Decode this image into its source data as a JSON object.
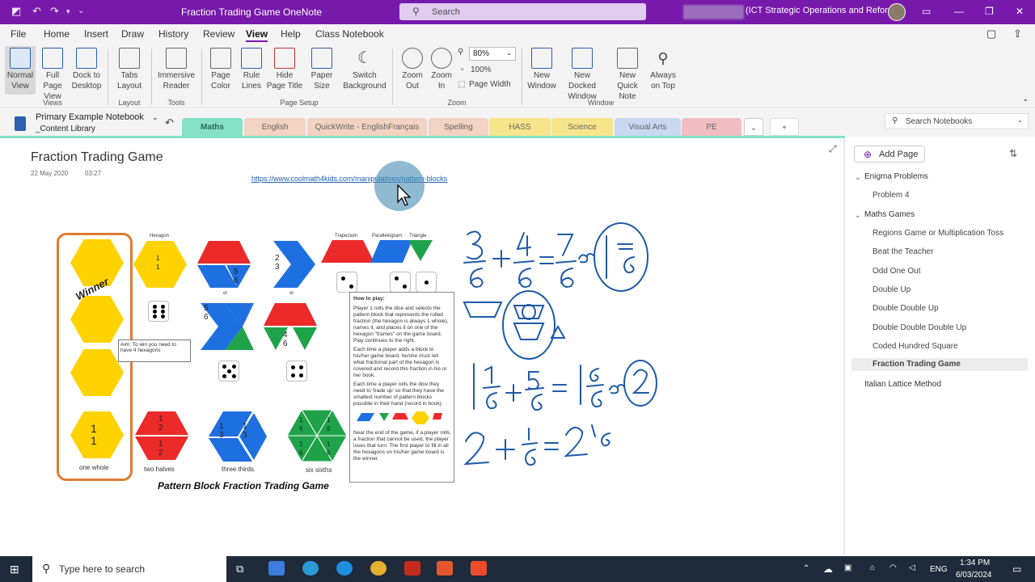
{
  "titlebar": {
    "app_title": "Fraction Trading Game   OneNote",
    "search_placeholder": "Search",
    "account": "(ICT Strategic Operations and Reform)"
  },
  "menu": {
    "items": [
      "File",
      "Home",
      "Insert",
      "Draw",
      "History",
      "Review",
      "View",
      "Help",
      "Class Notebook"
    ],
    "active": "View"
  },
  "ribbon": {
    "views": {
      "normal": "Normal View",
      "fullpage": "Full Page View",
      "dock": "Dock to Desktop",
      "group": "Views"
    },
    "layout": {
      "tabs": "Tabs Layout",
      "group": "Layout"
    },
    "tools": {
      "immersive": "Immersive Reader",
      "group": "Tools"
    },
    "pagesetup": {
      "color": "Page Color",
      "rule": "Rule Lines",
      "hide": "Hide Page Title",
      "paper": "Paper Size",
      "switchbg": "Switch Background",
      "group": "Page Setup"
    },
    "zoom": {
      "out": "Zoom Out",
      "in": "Zoom In",
      "value": "80%",
      "hundred": "100%",
      "pagewidth": "Page Width",
      "group": "Zoom"
    },
    "window": {
      "newwin": "New Window",
      "docked": "New Docked Window",
      "quicknote": "New Quick Note",
      "ontop": "Always on Top",
      "group": "Window"
    }
  },
  "notebook": {
    "name": "Primary Example Notebook",
    "section_group": "_Content Library",
    "tabs": [
      {
        "label": "Maths",
        "color": "#86e0c6"
      },
      {
        "label": "English",
        "color": "#f2d2c2"
      },
      {
        "label": "QuickWrite - EnglishFrançais",
        "color": "#f2d2c2"
      },
      {
        "label": "Spelling",
        "color": "#f2d2c2"
      },
      {
        "label": "HASS",
        "color": "#f7e58b"
      },
      {
        "label": "Science",
        "color": "#f7e58b"
      },
      {
        "label": "Visual Arts",
        "color": "#c9d8f0"
      },
      {
        "label": "PE",
        "color": "#f2bcc3"
      }
    ],
    "add_tab": "+",
    "search_placeholder": "Search Notebooks"
  },
  "page": {
    "title": "Fraction Trading Game",
    "date": "22 May 2020",
    "time": "03:27",
    "link": "https://www.coolmath4kids.com/manipulatives/pattern-blocks"
  },
  "worksheet": {
    "title": "Pattern Block Fraction Trading Game",
    "winner": "Winner",
    "aim": "Aim: To win you need to have 4 hexagons",
    "labels": {
      "hexagon": "Hexagon",
      "trapezium": "Trapezium",
      "parallelogram": "Parallelogram",
      "triangle": "Triangle",
      "or1": "or",
      "or2": "or"
    },
    "bottom_labels": [
      "one whole",
      "two halves",
      "three thirds",
      "six sixths"
    ],
    "fractions": {
      "one": "1",
      "half": "1\n2",
      "third": "1\n3",
      "sixth": "1\n6",
      "twothirds": "2\n3",
      "fivesixths": "5\n6",
      "foursixths": "4\n6"
    },
    "howto_title": "How to play:",
    "howto": [
      "Player 1 rolls the dice and selects the pattern block that represents the rolled fraction (the hexagon is always 1 whole), names it, and places it on one of the hexagon \"frames\" on the game board. Play continues to the right.",
      "Each time a player adds a block to his/her game board, he/she must tell what fractional part of the hexagon is covered and record this fraction in his or her book.",
      "Each time a player rolls the dice they need to 'trade up' so that they have the smallest number of pattern blocks possible in their hand (record in book).",
      "Near the end of the game, if a player rolls a fraction that cannot be used, the player loses that turn. The first player to fill in all the hexagons on his/her game board is the winner."
    ]
  },
  "ink": {
    "eq1": "3/6 + 4/6 = 7/6 or 1 1/6",
    "eq2": "1 1/6 + 5/6 = 1 6/6 or 2",
    "eq3": "2 + 1/6 = 2 1/6"
  },
  "pages_panel": {
    "add_page": "Add Page",
    "items": [
      {
        "label": "Enigma Problems",
        "level": 0,
        "expanded": true
      },
      {
        "label": "Problem 4",
        "level": 1
      },
      {
        "label": "Maths Games",
        "level": 0,
        "expanded": true
      },
      {
        "label": "Regions Game or Multiplication Toss",
        "level": 1
      },
      {
        "label": "Beat the Teacher",
        "level": 1
      },
      {
        "label": "Odd One Out",
        "level": 1
      },
      {
        "label": "Double Up",
        "level": 1
      },
      {
        "label": "Double Double Up",
        "level": 1
      },
      {
        "label": "Double Double Double Up",
        "level": 1
      },
      {
        "label": "Coded Hundred Square",
        "level": 1
      },
      {
        "label": "Fraction Trading Game",
        "level": 1,
        "selected": true
      },
      {
        "label": "Italian Lattice Method",
        "level": 0
      }
    ]
  },
  "taskbar": {
    "search_placeholder": "Type here to search",
    "time": "1:34 PM",
    "date": "6/03/2024",
    "lang": "ENG"
  },
  "colors": {
    "brand": "#7719aa",
    "maths_tab": "#86e0c6",
    "ink": "#1f5aa8",
    "hex_yellow": "#ffd200",
    "trap_red": "#ec2a2a",
    "rhombus_blue": "#1e6fe0",
    "tri_green": "#1fa34a"
  }
}
